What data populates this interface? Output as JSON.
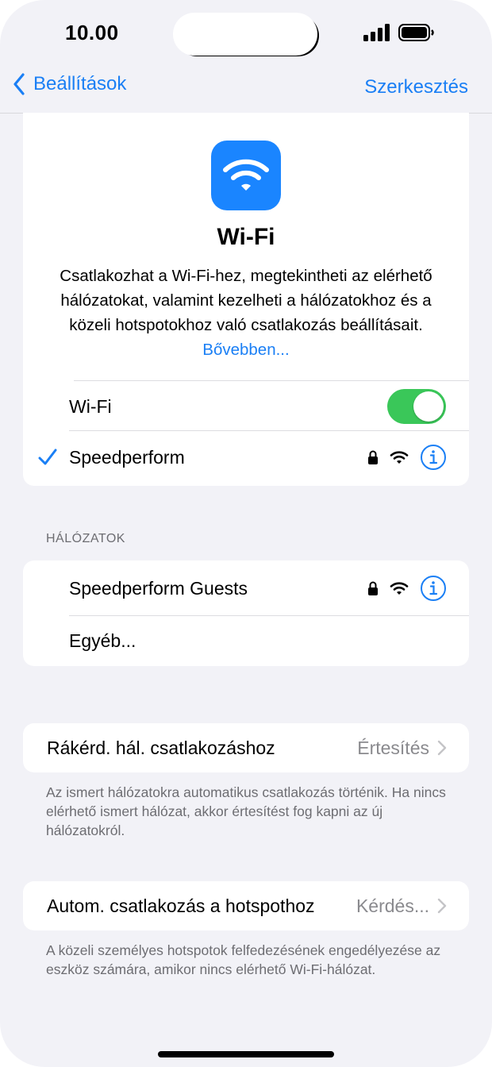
{
  "status": {
    "time": "10.00"
  },
  "nav": {
    "back_label": "Beállítások",
    "edit_label": "Szerkesztés"
  },
  "hero": {
    "title": "Wi-Fi",
    "description": "Csatlakozhat a Wi-Fi-hez, megtekintheti az elérhető hálózatokat, valamint kezelheti a hálózatokhoz és a közeli hotspotokhoz való csatlakozás beállításait.",
    "more_link": "Bővebben..."
  },
  "wifi_toggle": {
    "label": "Wi-Fi",
    "on": true
  },
  "connected": {
    "name": "Speedperform"
  },
  "networks": {
    "header": "HÁLÓZATOK",
    "items": [
      {
        "name": "Speedperform Guests"
      }
    ],
    "other": "Egyéb..."
  },
  "ask_join": {
    "label": "Rákérd. hál. csatlakozáshoz",
    "value": "Értesítés",
    "footnote": "Az ismert hálózatokra automatikus csatlakozás történik. Ha nincs elérhető ismert hálózat, akkor értesítést fog kapni az új hálózatokról."
  },
  "auto_hotspot": {
    "label": "Autom. csatlakozás a hotspothoz",
    "value": "Kérdés...",
    "footnote": "A közeli személyes hotspotok felfedezésének engedélyezése az eszköz számára, amikor nincs elérhető Wi-Fi-hálózat."
  },
  "colors": {
    "accent": "#1a7ff5",
    "toggle_on": "#3ac759",
    "wifi_icon_bg": "#1a85ff"
  }
}
